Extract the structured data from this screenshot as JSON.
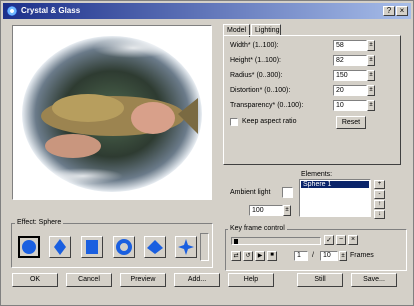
{
  "window": {
    "title": "Crystal & Glass"
  },
  "titlebar_buttons": {
    "help": "?",
    "close": "×"
  },
  "tabs": [
    {
      "label": "Model"
    },
    {
      "label": "Lighting"
    }
  ],
  "model": {
    "params": [
      {
        "label": "Width* (1..100):",
        "value": "58"
      },
      {
        "label": "Height* (1..100):",
        "value": "82"
      },
      {
        "label": "Radius* (0..300):",
        "value": "150"
      },
      {
        "label": "Distortion* (0..100):",
        "value": "20"
      },
      {
        "label": "Transparency* (0..100):",
        "value": "10"
      }
    ],
    "keep_aspect_label": "Keep aspect ratio",
    "reset_label": "Reset"
  },
  "ambient": {
    "label": "Ambient light",
    "value": "100"
  },
  "elements": {
    "label": "Elements:",
    "items": [
      "Sphere 1"
    ],
    "buttons": [
      "+",
      "-",
      "↑",
      "↓"
    ]
  },
  "keyframe": {
    "label": "Key frame control",
    "frame_current": "1",
    "frame_total": "10",
    "frames_label": "Frames",
    "sep": "/"
  },
  "effect": {
    "label": "Effect: Sphere"
  },
  "buttons": {
    "ok": "OK",
    "cancel": "Cancel",
    "preview": "Preview",
    "add": "Add...",
    "help": "Help",
    "still": "Still",
    "save": "Save..."
  },
  "colors": {
    "title_start": "#1b2f8a",
    "title_end": "#a7bde9",
    "effect_blue": "#1a5fe0",
    "face": "#d4d0c8"
  }
}
